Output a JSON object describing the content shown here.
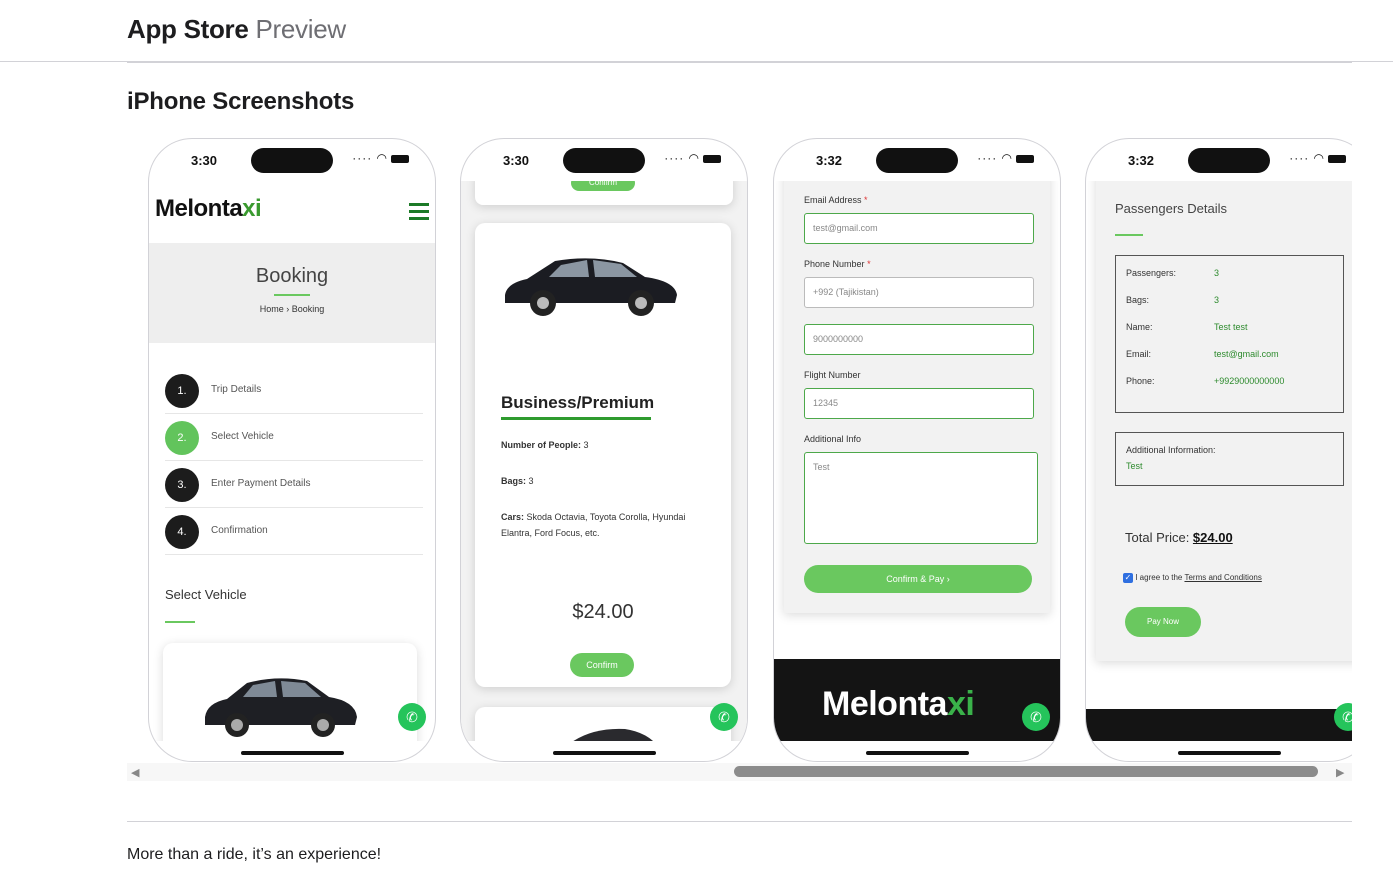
{
  "header": {
    "brand_app_store": "App Store",
    "brand_preview": "Preview"
  },
  "section_title": "iPhone Screenshots",
  "phones": [
    {
      "time": "3:30",
      "logo_main": "Melonta",
      "logo_x": "xi",
      "hero_title": "Booking",
      "breadcrumb": "Home › Booking",
      "steps": [
        {
          "num": "1.",
          "label": "Trip Details"
        },
        {
          "num": "2.",
          "label": "Select Vehicle"
        },
        {
          "num": "3.",
          "label": "Enter Payment Details"
        },
        {
          "num": "4.",
          "label": "Confirmation"
        }
      ],
      "section_heading": "Select Vehicle"
    },
    {
      "time": "3:30",
      "top_confirm": "Confirm",
      "vehicle_title": "Business/Premium",
      "people_label": "Number of People:",
      "people_value": " 3",
      "bags_label": "Bags:",
      "bags_value": " 3",
      "cars_label": "Cars:",
      "cars_value": " Skoda Octavia, Toyota Corolla, Hyundai Elantra, Ford Focus, etc.",
      "price": "$24.00",
      "confirm": "Confirm"
    },
    {
      "time": "3:32",
      "email_label": "Email Address",
      "email_value": "test@gmail.com",
      "phone_label": "Phone Number",
      "country_value": "+992 (Tajikistan)",
      "phone_value": "9000000000",
      "flight_label": "Flight Number",
      "flight_value": "12345",
      "info_label": "Additional Info",
      "info_value": "Test",
      "required_mark": "*",
      "button": "Confirm & Pay ›",
      "footer_logo_main": "Melonta",
      "footer_logo_x": "xi"
    },
    {
      "time": "3:32",
      "heading": "Passengers Details",
      "rows": [
        {
          "label": "Passengers:",
          "value": "3"
        },
        {
          "label": "Bags:",
          "value": "3"
        },
        {
          "label": "Name:",
          "value": "Test test"
        },
        {
          "label": "Email:",
          "value": "test@gmail.com"
        },
        {
          "label": "Phone:",
          "value": "+9929000000000"
        }
      ],
      "additional_label": "Additional Information:",
      "additional_value": "Test",
      "total_label": "Total Price: ",
      "total_value": "$24.00",
      "agree_text": "I agree to the ",
      "terms_link": "Terms and Conditions",
      "pay_button": "Pay Now"
    }
  ],
  "whatsapp_icon": "whatsapp-icon",
  "accent_color": "#6ac85f",
  "tagline": "More than a ride, it’s an experience!"
}
